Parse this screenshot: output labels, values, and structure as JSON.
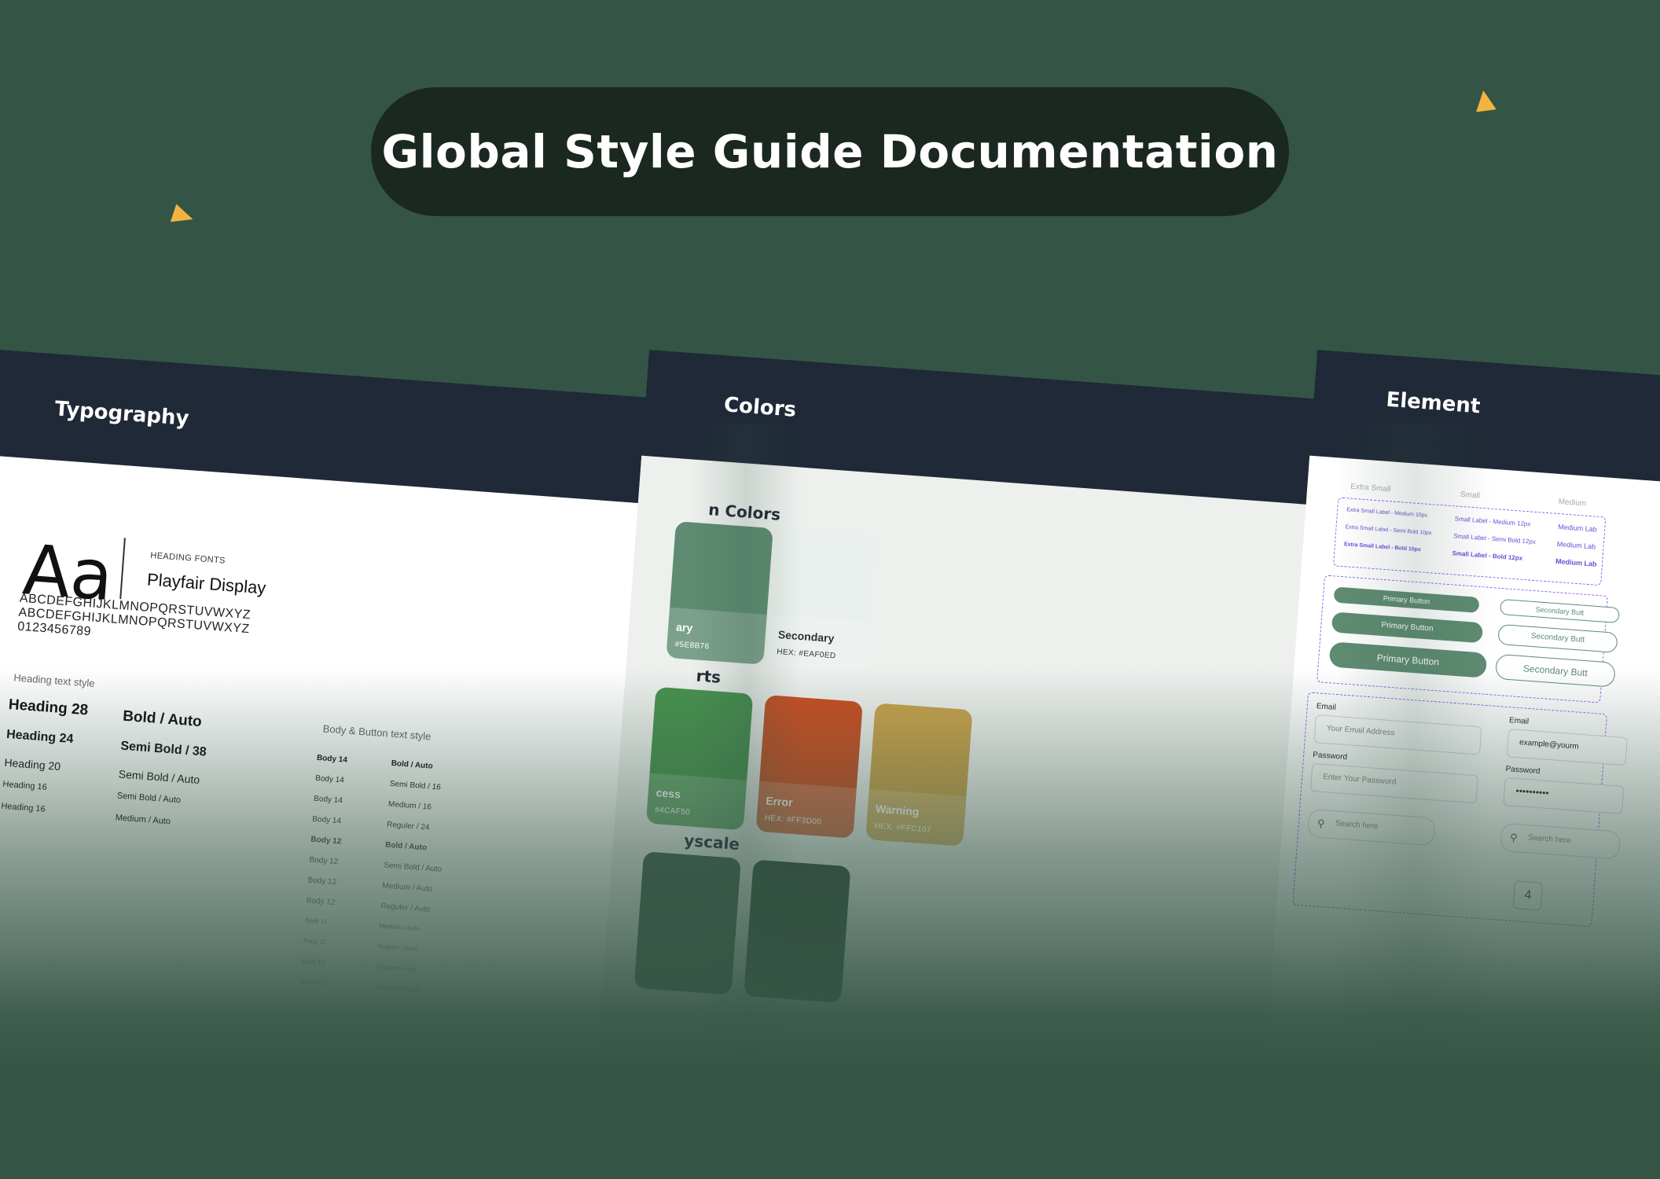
{
  "title": "Global Style Guide Documentation",
  "typography": {
    "header": "Typography",
    "aa": "Aa",
    "font_caption": "HEADING FONTS",
    "font_name": "Playfair Display",
    "uppercase": "ABCDEFGHIJKLMNOPQRSTUVWXYZ",
    "uppercase2": "ABCDEFGHIJKLMNOPQRSTUVWXYZ",
    "digits": "0123456789",
    "heading_caption": "Heading text style",
    "headings": [
      "Heading 28",
      "Heading 24",
      "Heading 20",
      "Heading 16",
      "Heading 16"
    ],
    "heading_weights": [
      "Bold / Auto",
      "Semi Bold / 38",
      "Semi Bold / Auto",
      "Semi Bold / Auto",
      "Medium / Auto"
    ],
    "body_caption": "Body & Button text style",
    "body_left": [
      "Body 14",
      "Body 14",
      "Body 14",
      "Body 14",
      "Body 12",
      "Body 12",
      "Body 12",
      "Body 12",
      "Body 11",
      "Body 11",
      "Body 10",
      "Button 14"
    ],
    "body_right": [
      "Bold / Auto",
      "Semi Bold / 16",
      "Medium / 16",
      "Reguler / 24",
      "Bold / Auto",
      "Semi Bold / Auto",
      "Medium / Auto",
      "Reguler / Auto",
      "Medium / Auto",
      "Reguler / Auto",
      "Reguler / Auto",
      "Semi Bold / Auto"
    ]
  },
  "colors": {
    "header": "Colors",
    "main_heading": "n Colors",
    "alerts_heading": "rts",
    "grey_heading": "yscale",
    "main": [
      {
        "name": "ary",
        "hex": "#5E8B76",
        "color": "#5e8b72",
        "text": "#ffffff"
      },
      {
        "name": "Secondary",
        "hex": "HEX: #EAF0ED",
        "color": "#eaf0ed",
        "text": "#333333"
      }
    ],
    "alerts": [
      {
        "name": "cess",
        "hex": "#4CAF50",
        "color": "#47914f",
        "text": "#ffffff"
      },
      {
        "name": "Error",
        "hex": "HEX: #FF3D00",
        "color": "#c94e23",
        "text": "#ffffff"
      },
      {
        "name": "Warning",
        "hex": "HEX: #FFC107",
        "color": "#c9a24c",
        "text": "#ffffff"
      }
    ],
    "greyscale": [
      {
        "color": "#3d5b4c"
      },
      {
        "color": "#2f4a3c"
      }
    ]
  },
  "element": {
    "header": "Element",
    "size_labels": [
      "Extra Small",
      "Small",
      "Medium"
    ],
    "label_rows": [
      [
        "Extra Small Label - Medium 10px",
        "Small Label - Medium 12px",
        "Medium Lab"
      ],
      [
        "Extra Small Label - Semi Bold 10px",
        "Small Label - Semi Bold 12px",
        "Medium Lab"
      ],
      [
        "Extra Small Label - Bold 10px",
        "Small Label - Bold 12px",
        "Medium Lab"
      ]
    ],
    "primary_button": "Primary Button",
    "secondary_button": "Secondary Butt",
    "email_label": "Email",
    "email_placeholder": "Your Email Address",
    "email_value": "example@yourm",
    "password_label": "Password",
    "password_placeholder": "Enter Your Password",
    "password_value": "••••••••••",
    "search_placeholder": "Search here",
    "search_placeholder2": "Search here",
    "counter": "4",
    "accent": "#5e8b72",
    "dash": "#8b5cf6"
  }
}
